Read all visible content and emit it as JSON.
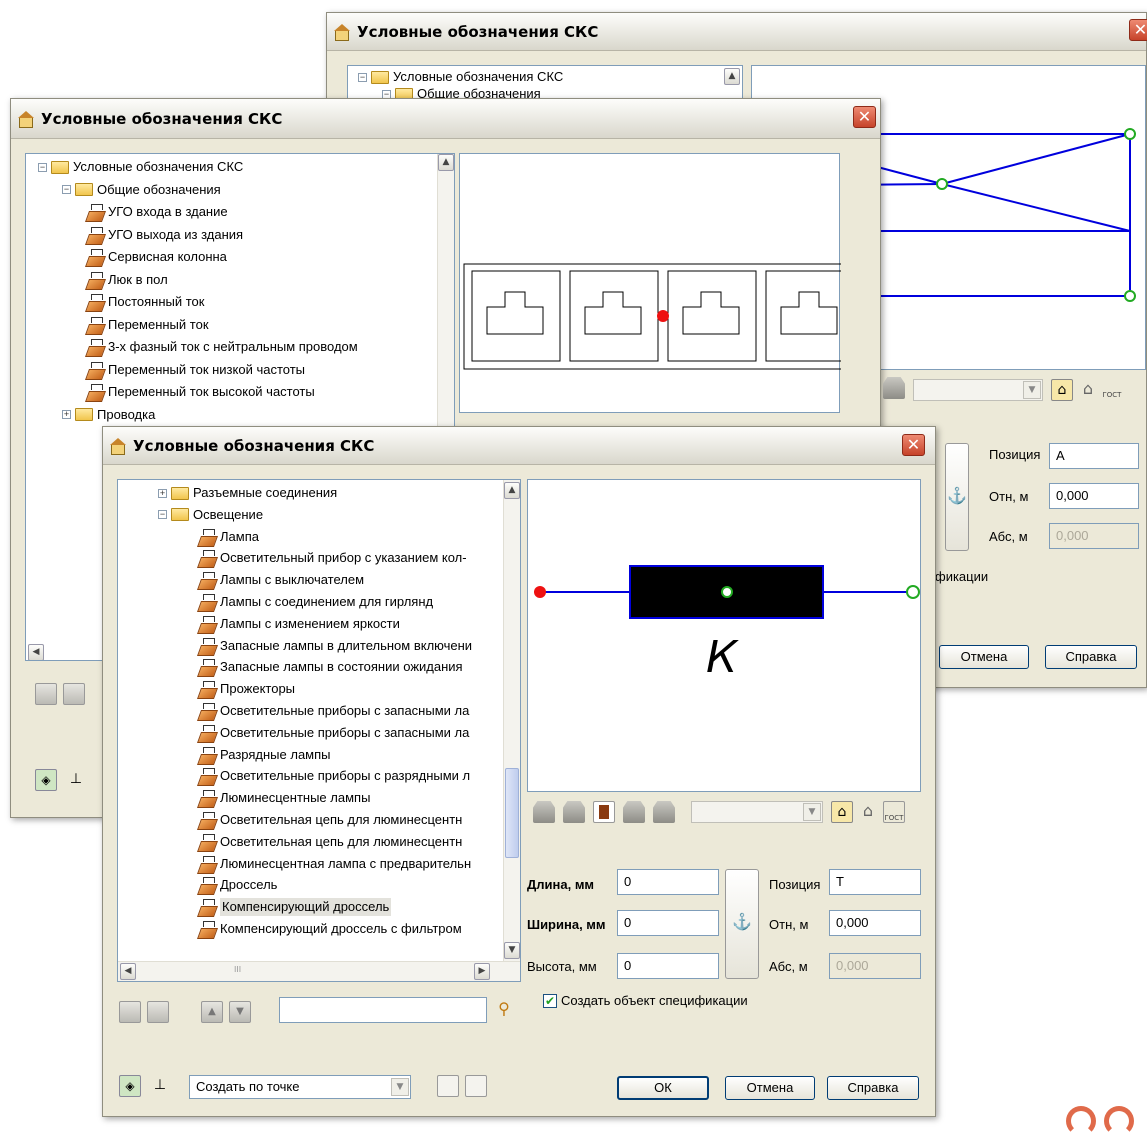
{
  "back_window": {
    "title": "Условные обозначения СКС",
    "tree": [
      "Условные обозначения СКС",
      "Общие обозначения"
    ],
    "position_label": "Позиция",
    "position_value": "А",
    "rel_label": "Отн, м",
    "rel_value": "0,000",
    "abs_label": "Абс, м",
    "abs_value": "0,000",
    "spec_partial": "фикации",
    "cancel": "Отмена",
    "help": "Справка"
  },
  "middle_window": {
    "title": "Условные обозначения СКС",
    "tree": [
      {
        "label": "Условные обозначения СКС",
        "kind": "root"
      },
      {
        "label": "Общие обозначения",
        "kind": "folder"
      },
      {
        "label": "УГО входа в здание",
        "kind": "item"
      },
      {
        "label": "УГО выхода из здания",
        "kind": "item"
      },
      {
        "label": "Сервисная колонна",
        "kind": "item"
      },
      {
        "label": "Люк в пол",
        "kind": "item"
      },
      {
        "label": "Постоянный ток",
        "kind": "item"
      },
      {
        "label": "Переменный ток",
        "kind": "item"
      },
      {
        "label": "3-х фазный ток с нейтральным проводом",
        "kind": "item"
      },
      {
        "label": "Переменный ток низкой частоты",
        "kind": "item"
      },
      {
        "label": "Переменный ток высокой частоты",
        "kind": "item"
      },
      {
        "label": "Проводка",
        "kind": "folder"
      }
    ]
  },
  "front_window": {
    "title": "Условные обозначения СКС",
    "tree": [
      {
        "label": "Разъемные соединения",
        "kind": "folder"
      },
      {
        "label": "Освещение",
        "kind": "folder"
      },
      {
        "label": "Лампа",
        "kind": "item"
      },
      {
        "label": "Осветительный прибор с указанием кол-",
        "kind": "item"
      },
      {
        "label": "Лампы с выключателем",
        "kind": "item"
      },
      {
        "label": "Лампы с соединением для гирлянд",
        "kind": "item"
      },
      {
        "label": "Лампы с изменением яркости",
        "kind": "item"
      },
      {
        "label": "Запасные лампы в длительном включени",
        "kind": "item"
      },
      {
        "label": "Запасные лампы в состоянии ожидания",
        "kind": "item"
      },
      {
        "label": "Прожекторы",
        "kind": "item"
      },
      {
        "label": "Осветительные приборы с запасными ла",
        "kind": "item"
      },
      {
        "label": "Осветительные приборы с запасными ла",
        "kind": "item"
      },
      {
        "label": "Разрядные лампы",
        "kind": "item"
      },
      {
        "label": "Осветительные приборы с разрядными л",
        "kind": "item"
      },
      {
        "label": "Люминесцентные лампы",
        "kind": "item"
      },
      {
        "label": "Осветительная цепь для люминесцентн",
        "kind": "item"
      },
      {
        "label": "Осветительная цепь для люминесцентн",
        "kind": "item"
      },
      {
        "label": "Люминесцентная лампа с предварительн",
        "kind": "item"
      },
      {
        "label": "Дроссель",
        "kind": "item"
      },
      {
        "label": "Компенсирующий дроссель",
        "kind": "item",
        "selected": true
      },
      {
        "label": "Компенсирующий дроссель с фильтром",
        "kind": "item"
      }
    ],
    "preview_text": "К",
    "length_label": "Длина, мм",
    "length_value": "0",
    "width_label": "Ширина, мм",
    "width_value": "0",
    "height_label": "Высота, мм",
    "height_value": "0",
    "position_label": "Позиция",
    "position_value": "Т",
    "rel_label": "Отн, м",
    "rel_value": "0,000",
    "abs_label": "Абс, м",
    "abs_value": "0,000",
    "create_spec": "Создать объект спецификации",
    "create_mode": "Создать по точке",
    "ok": "ОК",
    "cancel": "Отмена",
    "help": "Справка",
    "gost_label": "ГОСТ",
    "scroll_glyph": "III"
  }
}
